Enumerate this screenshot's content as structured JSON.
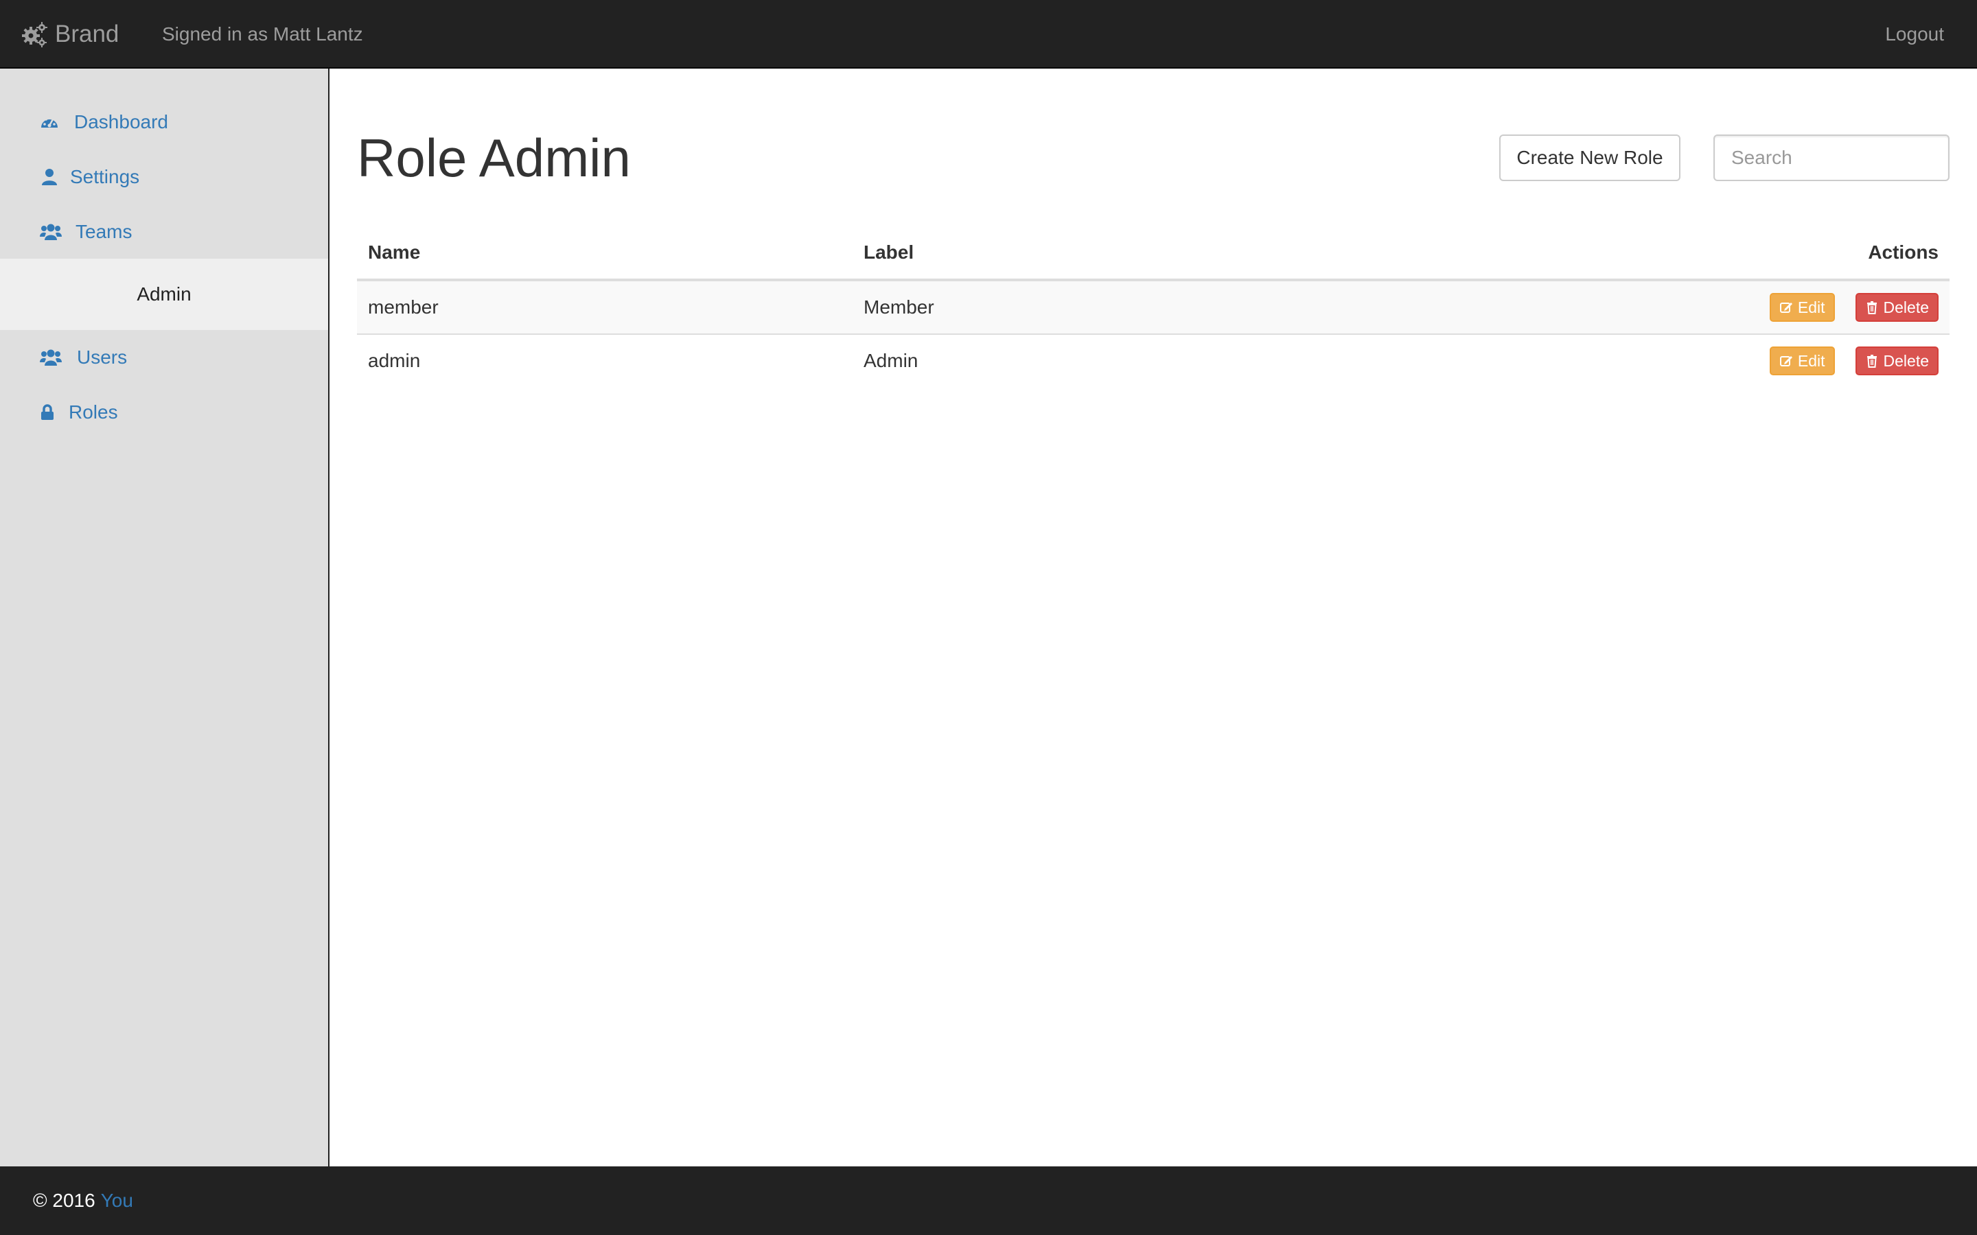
{
  "navbar": {
    "brand": "Brand",
    "signed_in": "Signed in as Matt Lantz",
    "logout": "Logout"
  },
  "sidebar": {
    "items_top": [
      {
        "label": "Dashboard",
        "icon": "dashboard-icon"
      },
      {
        "label": "Settings",
        "icon": "user-icon"
      },
      {
        "label": "Teams",
        "icon": "users-icon"
      }
    ],
    "section_header": "Admin",
    "items_admin": [
      {
        "label": "Users",
        "icon": "users-icon"
      },
      {
        "label": "Roles",
        "icon": "lock-icon"
      }
    ]
  },
  "main": {
    "title": "Role Admin",
    "create_button": "Create New Role",
    "search": {
      "placeholder": "Search",
      "value": ""
    },
    "table": {
      "columns": [
        "Name",
        "Label",
        "Actions"
      ],
      "rows": [
        {
          "name": "member",
          "label": "Member"
        },
        {
          "name": "admin",
          "label": "Admin"
        }
      ],
      "edit_label": "Edit",
      "delete_label": "Delete"
    }
  },
  "footer": {
    "copyright": "© 2016",
    "link": "You"
  },
  "colors": {
    "navbar": "#222222",
    "sidebar": "#dfdfdf",
    "link": "#337ab7",
    "warning": "#f0ad4e",
    "danger": "#d9534f"
  }
}
